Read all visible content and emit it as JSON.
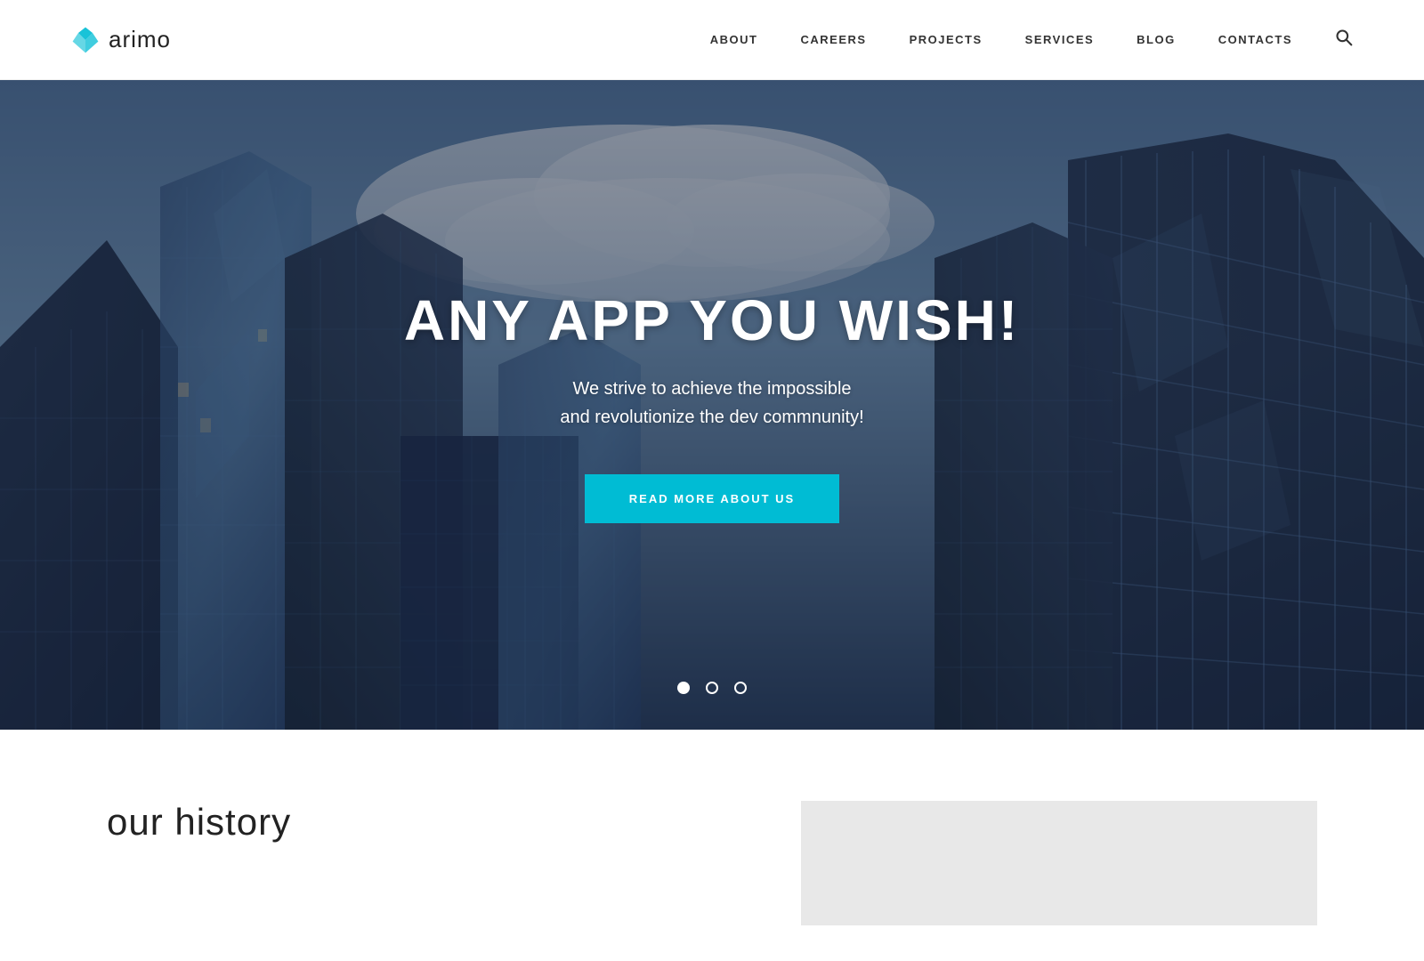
{
  "header": {
    "logo_text": "arimo",
    "nav_items": [
      {
        "label": "ABOUT",
        "id": "about"
      },
      {
        "label": "CAREERS",
        "id": "careers"
      },
      {
        "label": "PROJECTS",
        "id": "projects"
      },
      {
        "label": "SERVICES",
        "id": "services"
      },
      {
        "label": "BLOG",
        "id": "blog"
      },
      {
        "label": "CONTACTS",
        "id": "contacts"
      }
    ]
  },
  "hero": {
    "title": "ANY APP YOU WISH!",
    "subtitle_line1": "We strive to achieve the impossible",
    "subtitle_line2": "and revolutionize the dev commnunity!",
    "cta_label": "READ MORE ABOUT US",
    "dots": [
      {
        "state": "active"
      },
      {
        "state": "inactive"
      },
      {
        "state": "inactive"
      }
    ]
  },
  "below": {
    "history_title": "our history"
  },
  "colors": {
    "accent": "#00bcd4",
    "nav_text": "#333333",
    "hero_text": "#ffffff",
    "logo_text": "#222222"
  }
}
